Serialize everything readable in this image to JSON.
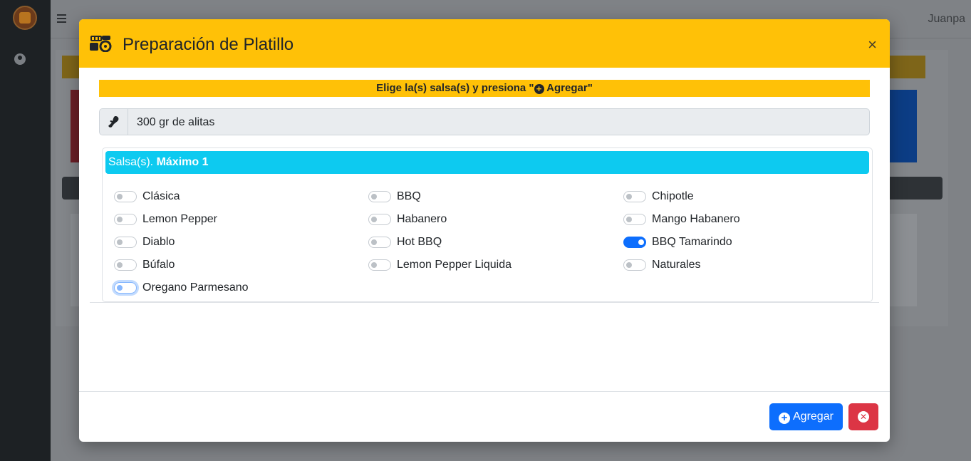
{
  "app": {
    "username": "Juanpa"
  },
  "modal": {
    "title": "Preparación de Platillo",
    "close_glyph": "×",
    "instruction_pre": "Elige la(s) salsa(s) y presiona \"",
    "instruction_button": "Agregar",
    "instruction_post": "\"",
    "product": "300 gr de alitas",
    "salsa_header_prefix": "Salsa(s). ",
    "salsa_header_max": "Máximo 1",
    "options": [
      {
        "label": "Clásica",
        "checked": false
      },
      {
        "label": "BBQ",
        "checked": false
      },
      {
        "label": "Chipotle",
        "checked": false
      },
      {
        "label": "Lemon Pepper",
        "checked": false
      },
      {
        "label": "Habanero",
        "checked": false
      },
      {
        "label": "Mango Habanero",
        "checked": false
      },
      {
        "label": "Diablo",
        "checked": false
      },
      {
        "label": "Hot BBQ",
        "checked": false
      },
      {
        "label": "BBQ Tamarindo",
        "checked": true
      },
      {
        "label": "Búfalo",
        "checked": false
      },
      {
        "label": "Lemon Pepper Liquida",
        "checked": false
      },
      {
        "label": "Naturales",
        "checked": false
      },
      {
        "label": "Oregano Parmesano",
        "checked": false,
        "focused": true
      }
    ],
    "add_button": "Agregar",
    "add_icon": "plus-circle-icon",
    "cancel_icon": "x-circle-icon"
  },
  "colors": {
    "header": "#ffc107",
    "info": "#0dcaf0",
    "primary": "#0d6efd",
    "danger": "#dc3545"
  }
}
